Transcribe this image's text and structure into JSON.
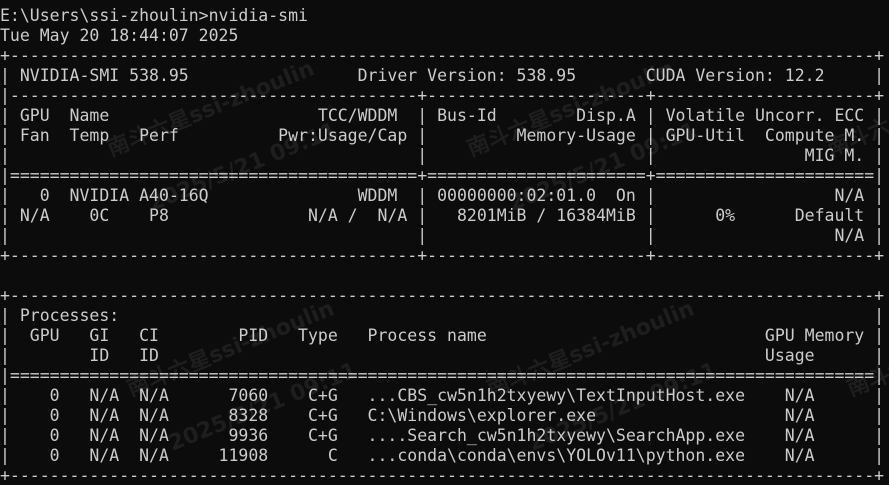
{
  "terminal": {
    "background": "#0c0c0c",
    "foreground": "#cccccc",
    "lines": [
      "E:\\Users\\ssi-zhoulin>nvidia-smi",
      "Tue May 20 18:44:07 2025",
      "+---------------------------------------------------------------------------------------+",
      "| NVIDIA-SMI 538.95                 Driver Version: 538.95       CUDA Version: 12.2     |",
      "|-----------------------------------------+----------------------+----------------------+",
      "| GPU  Name                     TCC/WDDM  | Bus-Id        Disp.A | Volatile Uncorr. ECC |",
      "| Fan  Temp   Perf          Pwr:Usage/Cap |         Memory-Usage | GPU-Util  Compute M. |",
      "|                                         |                      |               MIG M. |",
      "|=========================================+======================+======================|",
      "|   0  NVIDIA A40-16Q               WDDM  | 00000000:02:01.0  On |                  N/A |",
      "| N/A    0C    P8              N/A /  N/A |   8201MiB / 16384MiB |      0%      Default |",
      "|                                         |                      |                  N/A |",
      "+-----------------------------------------+----------------------+----------------------+",
      "",
      "+---------------------------------------------------------------------------------------+",
      "| Processes:                                                                            |",
      "|  GPU   GI   CI        PID   Type   Process name                            GPU Memory |",
      "|        ID   ID                                                             Usage      |",
      "|=======================================================================================|",
      "|    0   N/A  N/A      7060    C+G   ...CBS_cw5n1h2txyewy\\TextInputHost.exe    N/A      |",
      "|    0   N/A  N/A      8328    C+G   C:\\Windows\\explorer.exe                   N/A      |",
      "|    0   N/A  N/A      9936    C+G   ....Search_cw5n1h2txyewy\\SearchApp.exe    N/A      |",
      "|    0   N/A  N/A     11908      C   ...conda\\conda\\envs\\YOLOv11\\python.exe    N/A      |",
      "+---------------------------------------------------------------------------------------+"
    ]
  },
  "watermark": {
    "name": "南斗六星ssi-zhoulin",
    "date": "2025/5/21 09:11"
  }
}
